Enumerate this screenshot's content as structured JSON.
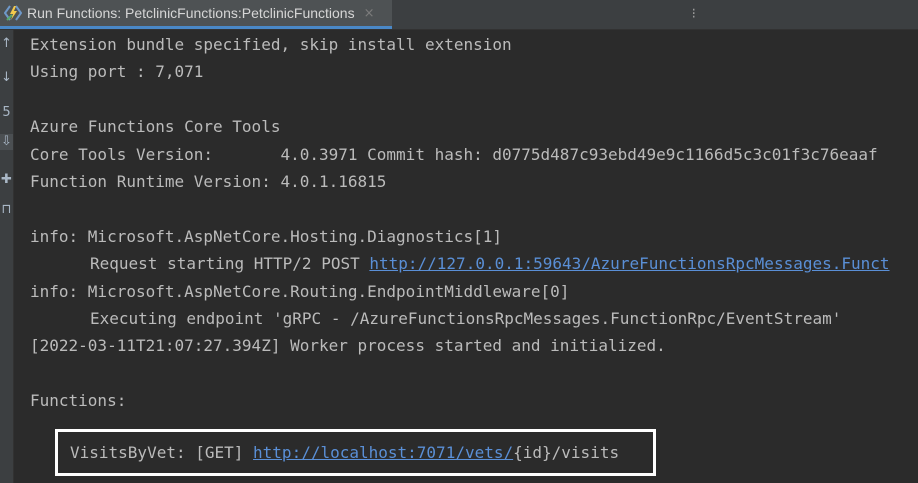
{
  "tab": {
    "label": "Run Functions: PetclinicFunctions:PetclinicFunctions",
    "close_glyph": "×"
  },
  "more_glyph": "⁝",
  "toolstrip": {
    "icons": [
      {
        "name": "rerun-icon",
        "glyph": "↑"
      },
      {
        "name": "stop-icon",
        "glyph": "↓"
      },
      {
        "name": "restore-icon",
        "glyph": "5"
      },
      {
        "name": "scroll-to-end-icon",
        "glyph": "⇩"
      },
      {
        "name": "pin-icon",
        "glyph": "✚"
      },
      {
        "name": "trash-icon",
        "glyph": "⊓"
      }
    ]
  },
  "console": {
    "line1": "Extension bundle specified, skip install extension",
    "line2": "Using port : 7,071",
    "line3": "Azure Functions Core Tools",
    "line4": "Core Tools Version:       4.0.3971 Commit hash: d0775d487c93ebd49e9c1166d5c3c01f3c76eaaf",
    "line5": "Function Runtime Version: 4.0.1.16815",
    "line6": "info: Microsoft.AspNetCore.Hosting.Diagnostics[1]",
    "line7_prefix": "Request starting HTTP/2 POST ",
    "line7_link": "http://127.0.0.1:59643/AzureFunctionsRpcMessages.Funct",
    "line8": "info: Microsoft.AspNetCore.Routing.EndpointMiddleware[0]",
    "line9": "Executing endpoint 'gRPC - /AzureFunctionsRpcMessages.FunctionRpc/EventStream'",
    "line10": "[2022-03-11T21:07:27.394Z] Worker process started and initialized.",
    "line11": "Functions:",
    "func_prefix": "VisitsByVet: [GET] ",
    "func_link": "http://localhost:7071/vets/",
    "func_suffix": "{id}/visits"
  },
  "colors": {
    "background": "#2b2b2b",
    "text": "#bbbbbb",
    "link": "#5a8fd6",
    "tab_underline": "#4a88c7",
    "highlight_border": "#ffffff"
  }
}
